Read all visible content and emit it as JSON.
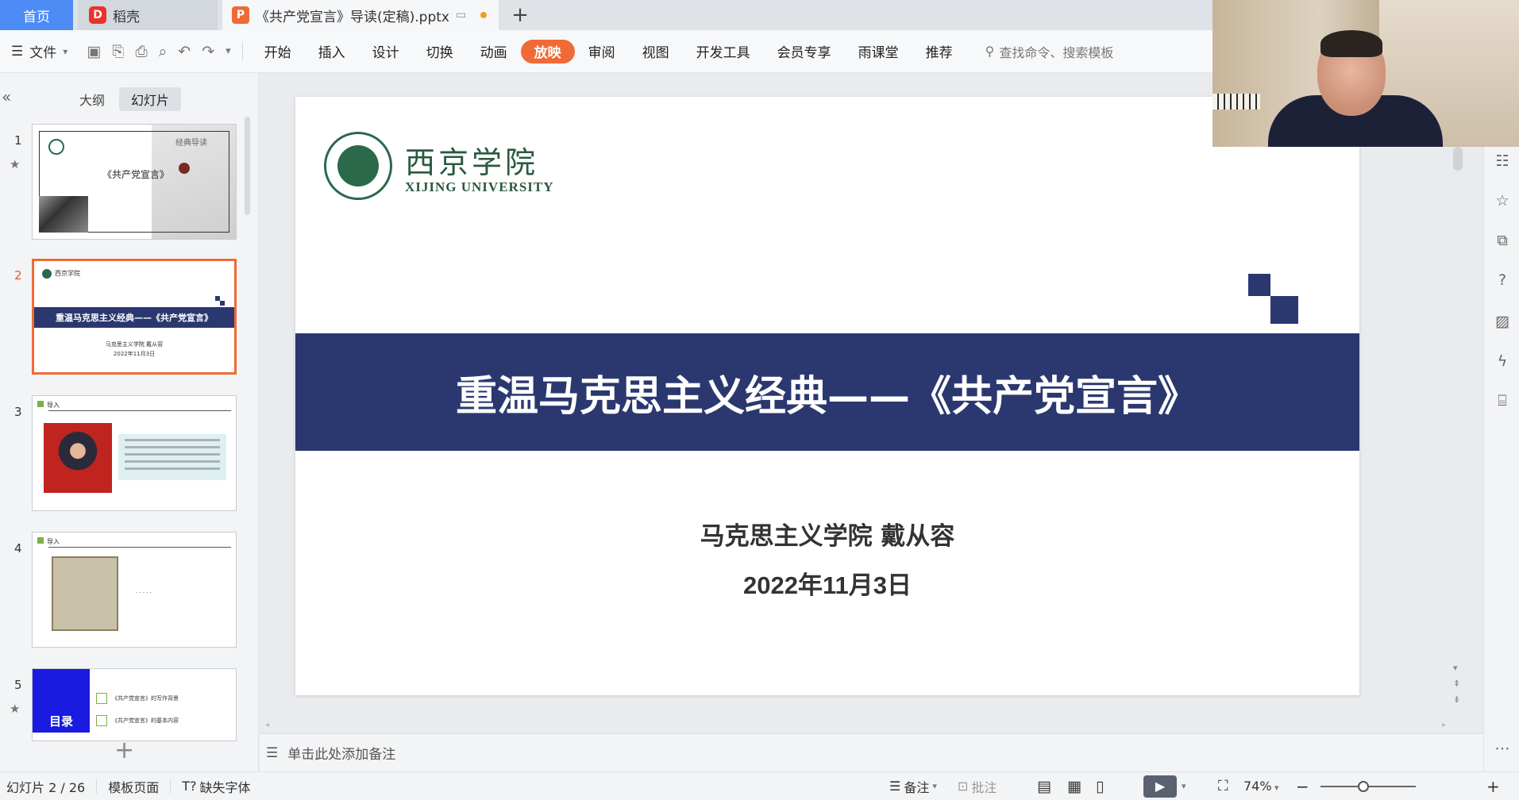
{
  "tabs": {
    "home": "首页",
    "daoke": "稻壳",
    "document": "《共产党宣言》导读(定稿).pptx",
    "new_tab": "+"
  },
  "toolbar": {
    "file": "文件",
    "menu": [
      "开始",
      "插入",
      "设计",
      "切换",
      "动画",
      "放映",
      "审阅",
      "视图",
      "开发工具",
      "会员专享",
      "雨课堂",
      "推荐"
    ],
    "active_menu": "放映",
    "search_placeholder": "查找命令、搜索模板"
  },
  "left_panel": {
    "tab_outline": "大纲",
    "tab_slides": "幻灯片",
    "thumbnails": [
      {
        "num": "1",
        "title": "《共产党宣言》",
        "heading": "经典导读"
      },
      {
        "num": "2",
        "title": "重温马克思主义经典——《共产党宣言》",
        "logo_text": "西京学院",
        "sub1": "马克思主义学院 戴从容",
        "sub2": "2022年11月3日"
      },
      {
        "num": "3",
        "header": "导入"
      },
      {
        "num": "4",
        "header": "导入"
      },
      {
        "num": "5",
        "toc": "目录",
        "items": [
          "《共产党宣言》的写作背景",
          "《共产党宣言》的基本内容"
        ]
      }
    ]
  },
  "slide": {
    "logo_cn": "西京学院",
    "logo_en": "XIJING UNIVERSITY",
    "title": "重温马克思主义经典——《共产党宣言》",
    "author": "马克思主义学院 戴从容",
    "date": "2022年11月3日"
  },
  "notes_placeholder": "单击此处添加备注",
  "status": {
    "slide_counter": "幻灯片 2 / 26",
    "template": "模板页面",
    "missing_fonts": "缺失字体",
    "notes": "备注",
    "comments": "批注",
    "zoom": "74%",
    "zoom_level": 0.45
  },
  "colors": {
    "accent": "#f06a35",
    "slide_band": "#2b3870",
    "home_tab": "#4d8cf5"
  }
}
